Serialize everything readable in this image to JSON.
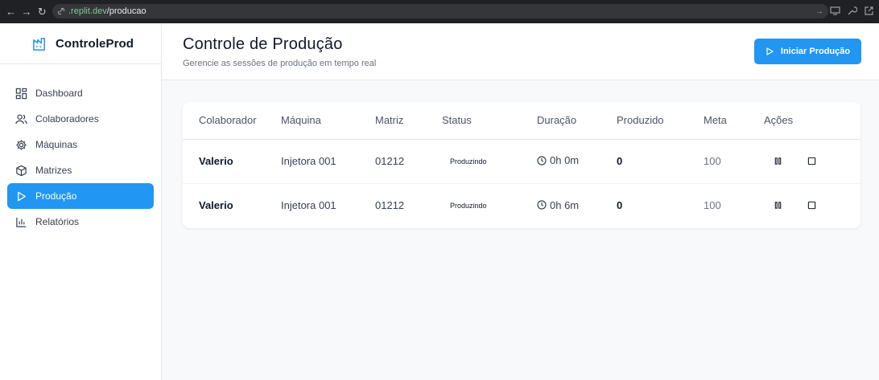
{
  "browser": {
    "url_host_prefix": "",
    "url_host_highlight": ".replit.dev",
    "url_path": "/producao"
  },
  "brand": {
    "name": "ControleProd",
    "icon": "factory-icon"
  },
  "sidebar": {
    "items": [
      {
        "label": "Dashboard",
        "icon": "grid-icon",
        "active": false
      },
      {
        "label": "Colaboradores",
        "icon": "users-icon",
        "active": false
      },
      {
        "label": "Máquinas",
        "icon": "gear-icon",
        "active": false
      },
      {
        "label": "Matrizes",
        "icon": "box-icon",
        "active": false
      },
      {
        "label": "Produção",
        "icon": "play-icon",
        "active": true
      },
      {
        "label": "Relatórios",
        "icon": "bar-chart-icon",
        "active": false
      }
    ]
  },
  "header": {
    "title": "Controle de Produção",
    "subtitle": "Gerencie as sessões de produção em tempo real",
    "start_button_label": "Iniciar Produção"
  },
  "table": {
    "columns": [
      "Colaborador",
      "Máquina",
      "Matriz",
      "Status",
      "Duração",
      "Produzido",
      "Meta",
      "Ações"
    ],
    "rows": [
      {
        "colaborador": "Valerio",
        "maquina": "Injetora 001",
        "matriz": "01212",
        "status": "Produzindo",
        "duracao": "0h 0m",
        "produzido": "0",
        "meta": "100"
      },
      {
        "colaborador": "Valerio",
        "maquina": "Injetora 001",
        "matriz": "01212",
        "status": "Produzindo",
        "duracao": "0h 6m",
        "produzido": "0",
        "meta": "100"
      }
    ]
  },
  "colors": {
    "accent": "#2196f3",
    "sidebar_bg": "#ffffff",
    "page_bg": "#f8f9fb"
  }
}
